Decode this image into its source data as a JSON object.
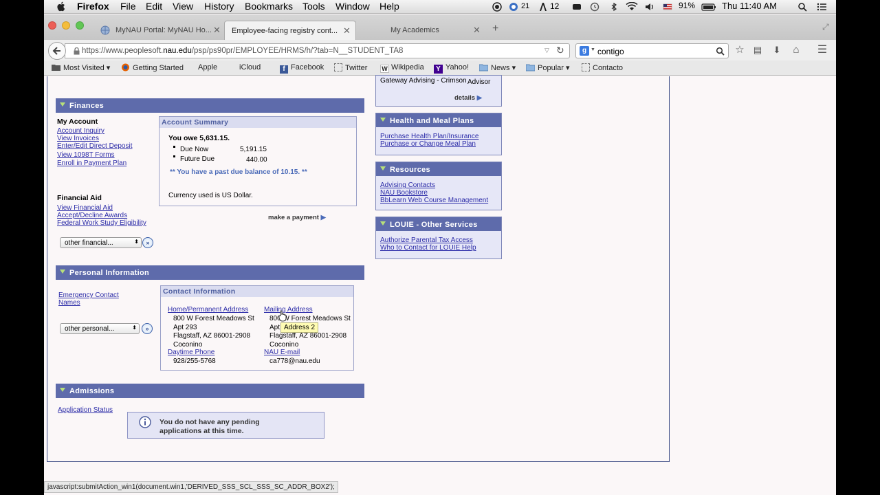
{
  "menubar": {
    "app": "Firefox",
    "items": [
      "File",
      "Edit",
      "View",
      "History",
      "Bookmarks",
      "Tools",
      "Window",
      "Help"
    ],
    "status": {
      "badge_count": "21",
      "adobe_count": "12",
      "battery": "91%",
      "clock": "Thu 11:40 AM"
    }
  },
  "tabs": [
    {
      "label": "MyNAU Portal: MyNAU Ho..."
    },
    {
      "label": "Employee-facing registry cont..."
    },
    {
      "label": "My Academics"
    }
  ],
  "navbar": {
    "url_prefix": "https://www.peoplesoft.",
    "url_domain": "nau.edu",
    "url_suffix": "/psp/ps90pr/EMPLOYEE/HRMS/h/?tab=N__STUDENT_TA8",
    "search_value": "contigo"
  },
  "bookmarks": [
    "Most Visited",
    "Getting Started",
    "Apple",
    "iCloud",
    "Facebook",
    "Twitter",
    "Wikipedia",
    "Yahoo!",
    "News",
    "Popular",
    "Contacto"
  ],
  "finances": {
    "title": "Finances",
    "my_account": "My Account",
    "account_links": [
      "Account Inquiry",
      "View Invoices",
      "Enter/Edit Direct Deposit",
      "View 1098T Forms",
      "Enroll in Payment Plan"
    ],
    "financial_aid": "Financial Aid",
    "aid_links": [
      "View Financial Aid",
      "Accept/Decline Awards",
      "Federal Work Study Eligibility"
    ],
    "other_select": "other financial...",
    "summary": {
      "title": "Account Summary",
      "you_owe": "You owe 5,631.15.",
      "due_now_label": "Due Now",
      "due_now_value": "5,191.15",
      "future_due_label": "Future Due",
      "future_due_value": "440.00",
      "past_due": "** You have a past due balance of 10.15. **",
      "currency": "Currency used is US Dollar."
    },
    "make_payment": "make a payment"
  },
  "personal": {
    "title": "Personal Information",
    "emergency_link_1": "Emergency Contact",
    "emergency_link_2": "Names",
    "other_select": "other personal...",
    "contact": {
      "title": "Contact Information",
      "home_link": "Home/Permanent Address",
      "home_lines": [
        "800 W Forest Meadows St",
        "Apt 293",
        "Flagstaff, AZ 86001-2908",
        "Coconino"
      ],
      "mailing_link": "Mailing Address",
      "mailing_lines": [
        "800 W Forest Meadows St",
        "Apt",
        "Flagstaff, AZ 86001-2908",
        "Coconino"
      ],
      "phone_link": "Daytime Phone",
      "phone": "928/255-5768",
      "email_link": "NAU E-mail",
      "email": "ca778@nau.edu"
    },
    "tooltip": "Address 2"
  },
  "admissions": {
    "title": "Admissions",
    "status_link": "Application Status",
    "info_line1": "You do not have any pending",
    "info_line2": "applications at this time."
  },
  "right": {
    "advisor_text": "Gateway Advising - Crimson",
    "advisor_label": "Advisor",
    "details": "details",
    "health": {
      "title": "Health and Meal Plans",
      "links": [
        "Purchase Health Plan/Insurance",
        "Purchase or Change Meal Plan"
      ]
    },
    "resources": {
      "title": "Resources",
      "links": [
        "Advising Contacts",
        "NAU Bookstore",
        "BbLearn Web Course Management"
      ]
    },
    "louie": {
      "title": "LOUIE - Other Services",
      "links": [
        "Authorize Parental Tax Access",
        "Who to Contact for LOUIE Help"
      ]
    }
  },
  "statusbar": "javascript:submitAction_win1(document.win1,'DERIVED_SSS_SCL_SSS_SC_ADDR_BOX2');"
}
